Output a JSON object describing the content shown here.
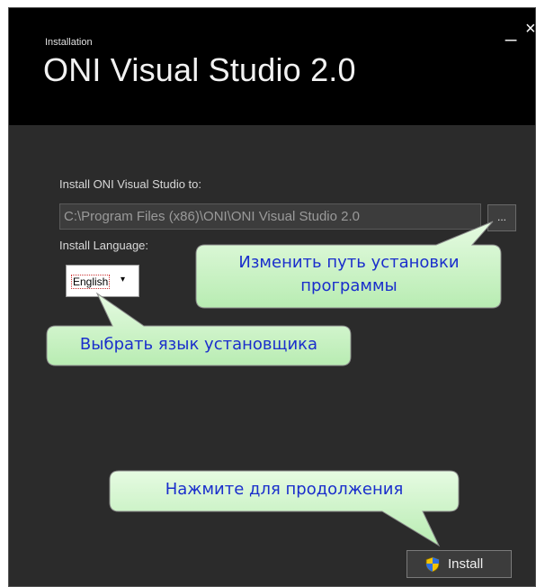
{
  "window": {
    "subtitle": "Installation",
    "title": "ONI Visual Studio 2.0",
    "minimize_glyph": "_",
    "close_glyph": "×"
  },
  "install_path": {
    "label": "Install ONI Visual Studio to:",
    "value": "C:\\Program Files (x86)\\ONI\\ONI Visual Studio 2.0",
    "browse_label": "..."
  },
  "language": {
    "label": "Install Language:",
    "selected": "English",
    "caret": "▾"
  },
  "install_button": {
    "label": "Install",
    "icon": "shield-icon"
  },
  "callouts": {
    "change_path": "Изменить путь установки программы",
    "select_language": "Выбрать язык установщика",
    "press_continue": "Нажмите для продолжения"
  },
  "colors": {
    "header_bg": "#000000",
    "body_bg": "#2b2b2b",
    "callout_fill": "#ccf5c8",
    "callout_text": "#1a2ecc"
  }
}
